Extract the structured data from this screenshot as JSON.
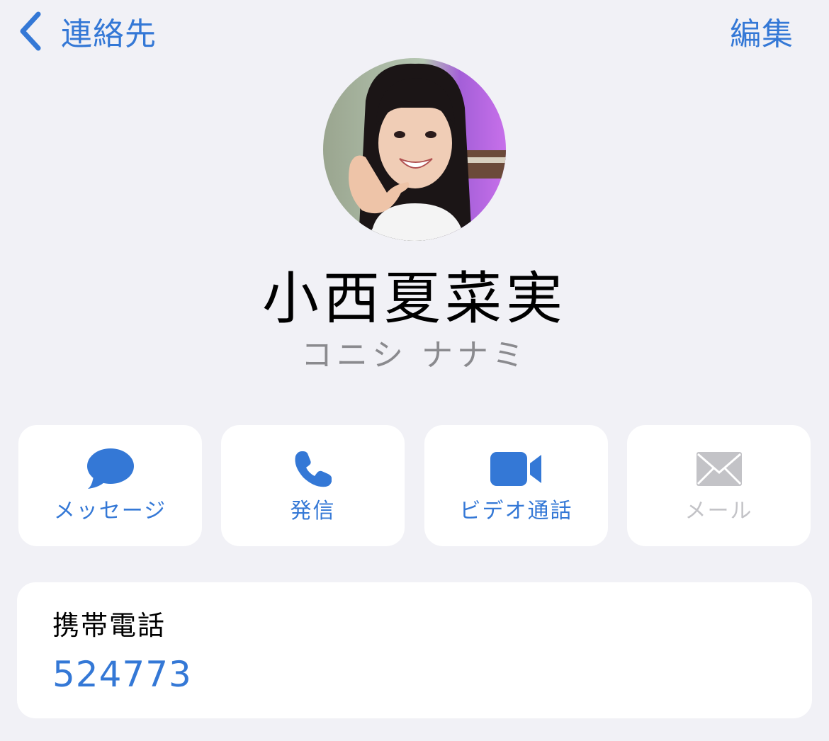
{
  "nav": {
    "back_label": "連絡先",
    "edit_label": "編集"
  },
  "contact": {
    "name": "小西夏菜実",
    "reading": "コニシ ナナミ"
  },
  "actions": [
    {
      "label": "メッセージ",
      "icon": "message-bubble-icon",
      "enabled": true
    },
    {
      "label": "発信",
      "icon": "phone-icon",
      "enabled": true
    },
    {
      "label": "ビデオ通話",
      "icon": "video-camera-icon",
      "enabled": true
    },
    {
      "label": "メール",
      "icon": "mail-envelope-icon",
      "enabled": false
    }
  ],
  "phone": {
    "label": "携帯電話",
    "number": "524773"
  },
  "colors": {
    "accent": "#3478d6",
    "background": "#f1f1f6",
    "card": "#ffffff",
    "secondary_text": "#8a8a8e",
    "disabled": "#c3c3c7"
  }
}
